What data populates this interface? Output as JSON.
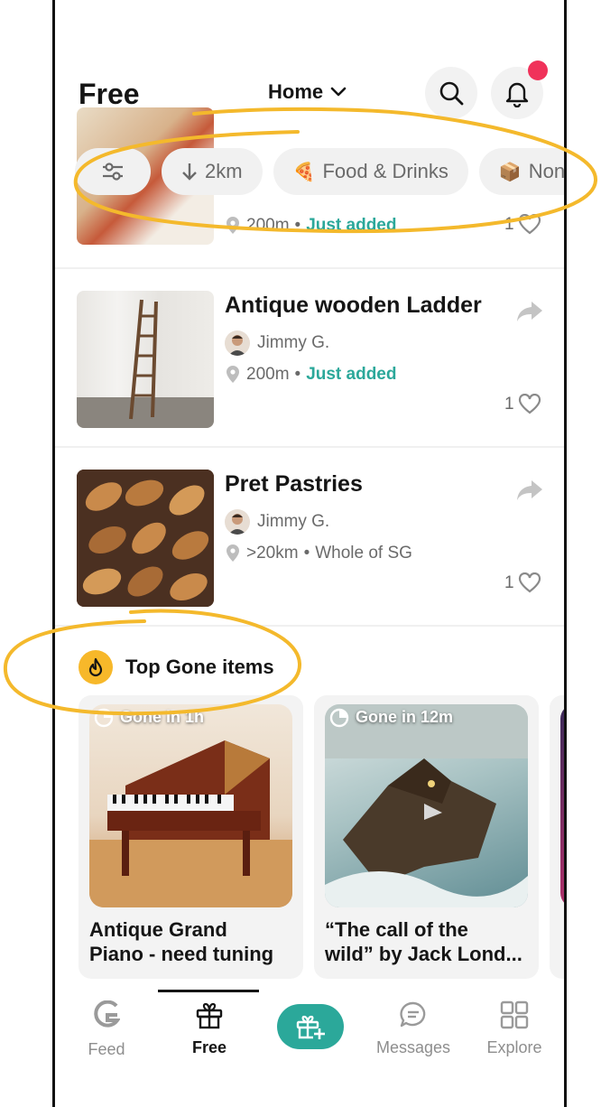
{
  "header": {
    "title": "Free",
    "location_label": "Home"
  },
  "chips": [
    {
      "icon": "sliders-icon",
      "label": ""
    },
    {
      "icon": "arrow-down-icon",
      "label": "2km"
    },
    {
      "icon": "pizza-icon",
      "label": "Food & Drinks"
    },
    {
      "icon": "box-icon",
      "label": "Non-f"
    }
  ],
  "partial_row": {
    "distance": "200m",
    "status": "Just added",
    "likes": "1"
  },
  "rows": [
    {
      "title": "Antique wooden Ladder",
      "owner": "Jimmy G.",
      "distance": "200m",
      "status": "Just added",
      "likes": "1"
    },
    {
      "title": "Pret Pastries",
      "owner": "Jimmy G.",
      "distance": ">20km",
      "status": "Whole of SG",
      "likes": "1"
    }
  ],
  "section": {
    "title": "Top Gone items"
  },
  "cards": [
    {
      "gone": "Gone in 1h",
      "title": "Antique Grand\nPiano - need tuning"
    },
    {
      "gone": "Gone in 12m",
      "title": "“The call of the\nwild” by Jack Lond..."
    }
  ],
  "nav": {
    "feed": "Feed",
    "free": "Free",
    "messages": "Messages",
    "explore": "Explore"
  },
  "colors": {
    "accent": "#2ba89a",
    "notification": "#f0325a",
    "highlight": "#f7b82a"
  }
}
